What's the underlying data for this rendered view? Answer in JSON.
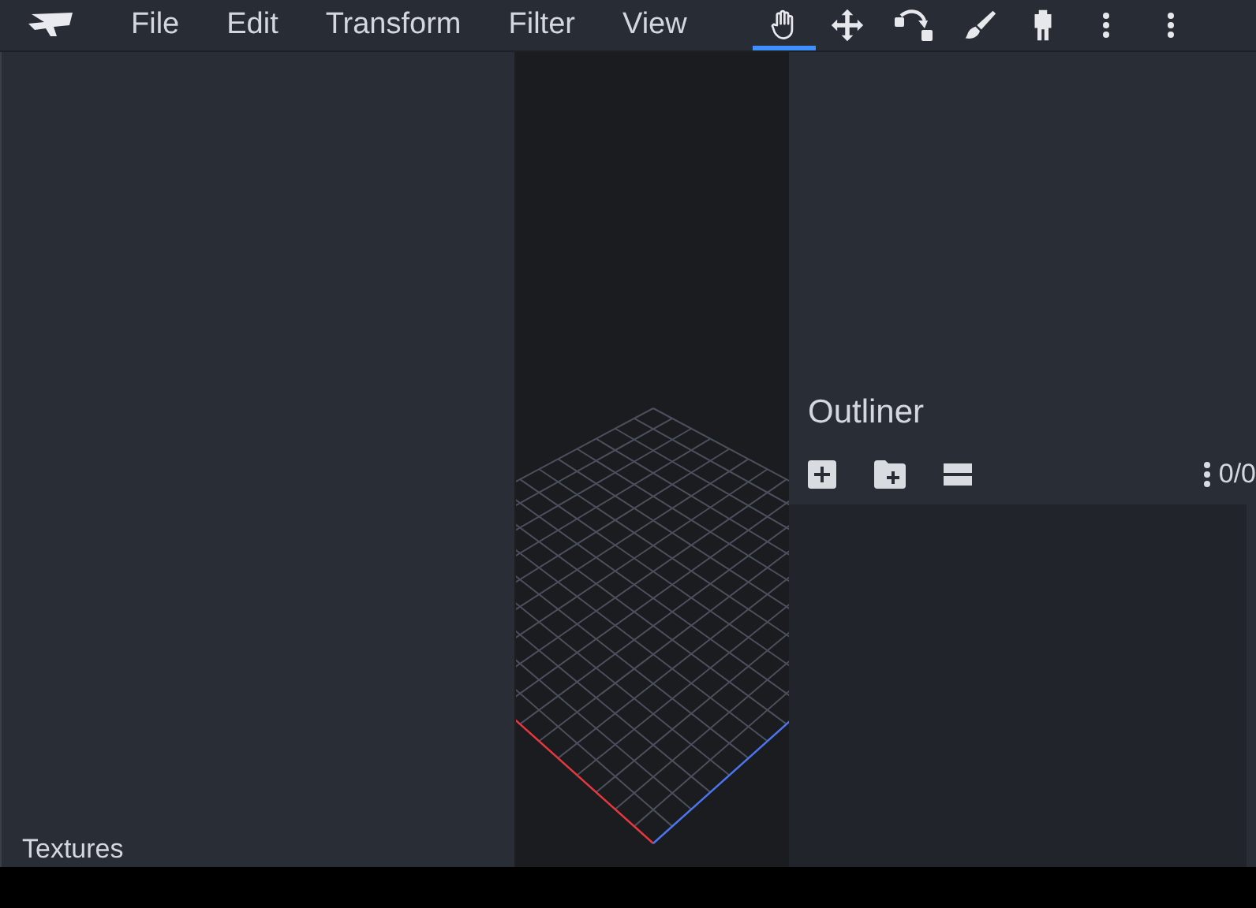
{
  "menu": [
    "File",
    "Edit",
    "Transform",
    "Filter",
    "View"
  ],
  "tools": [
    {
      "kind": "hand",
      "selected": true
    },
    {
      "kind": "move",
      "selected": false
    },
    {
      "kind": "pivot",
      "selected": false
    },
    {
      "kind": "paint",
      "selected": false
    },
    {
      "kind": "figure",
      "selected": false
    },
    {
      "kind": "more",
      "selected": false
    }
  ],
  "left_panel": {
    "title": "Textures"
  },
  "outliner": {
    "title": "Outliner",
    "counter": "0/0"
  }
}
